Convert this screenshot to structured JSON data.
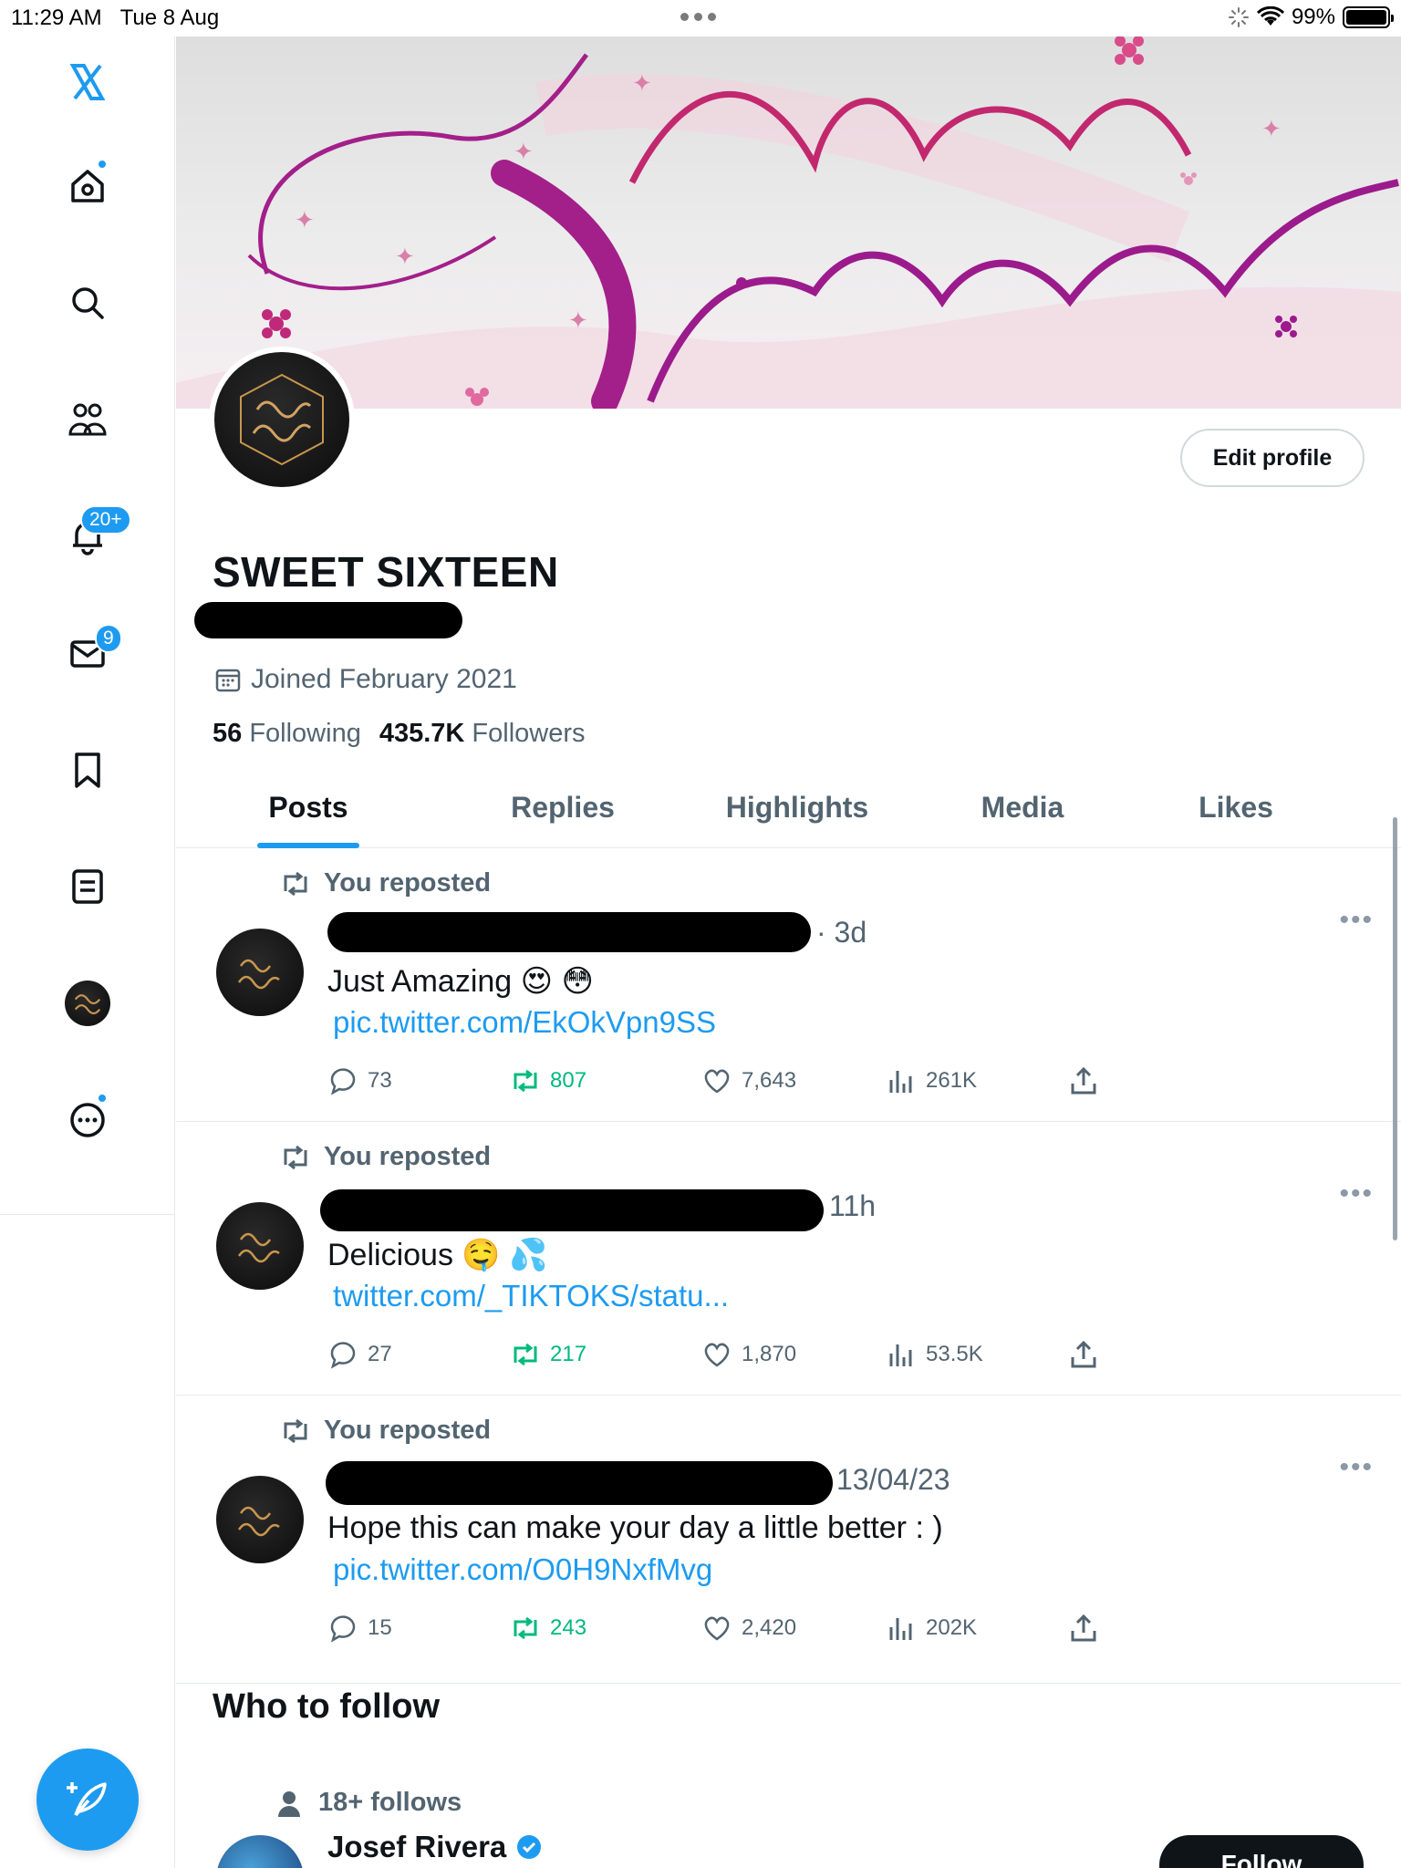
{
  "status_bar": {
    "time": "11:29 AM",
    "date": "Tue 8 Aug",
    "battery": "99%"
  },
  "sidebar": {
    "notifications_badge": "20+",
    "messages_badge": "9",
    "items": [
      "x-logo",
      "home",
      "search",
      "communities",
      "notifications",
      "messages",
      "bookmarks",
      "lists",
      "profile",
      "more"
    ]
  },
  "profile": {
    "display_name": "SWEET SIXTEEN",
    "edit_button": "Edit profile",
    "joined": "Joined February 2021",
    "following_count": "56",
    "following_label": "Following",
    "followers_count": "435.7K",
    "followers_label": "Followers"
  },
  "tabs": [
    "Posts",
    "Replies",
    "Highlights",
    "Media",
    "Likes"
  ],
  "posts": [
    {
      "repost_label": "You reposted",
      "time": "· 3d",
      "text": "Just Amazing 😍 😳",
      "link": "pic.twitter.com/EkOkVpn9SS",
      "replies": "73",
      "reposts": "807",
      "likes": "7,643",
      "views": "261K"
    },
    {
      "repost_label": "You reposted",
      "time": "11h",
      "text": "Delicious 🤤 💦",
      "link": "twitter.com/_TIKTOKS/statu...",
      "replies": "27",
      "reposts": "217",
      "likes": "1,870",
      "views": "53.5K"
    },
    {
      "repost_label": "You reposted",
      "time": "13/04/23",
      "text": "Hope this can make your day a little better : )",
      "link": "pic.twitter.com/O0H9NxfMvg",
      "replies": "15",
      "reposts": "243",
      "likes": "2,420",
      "views": "202K"
    }
  ],
  "who_to_follow": {
    "title": "Who to follow",
    "follows_label": "18+ follows",
    "name": "Josef Rivera",
    "follow_button": "Follow"
  },
  "colors": {
    "accent": "#1d9bf0",
    "repost_green": "#00ba7c",
    "text_secondary": "#536471"
  }
}
